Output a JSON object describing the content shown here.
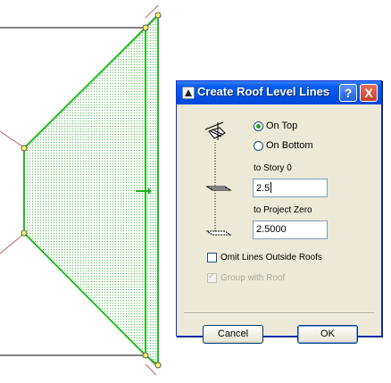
{
  "dialog": {
    "title": "Create Roof Level Lines",
    "help_button": "?",
    "close_button": "X",
    "placement": {
      "on_top_label": "On Top",
      "on_bottom_label": "On Bottom",
      "selected": "On Top"
    },
    "story": {
      "label": "to Story 0",
      "value": "2.5"
    },
    "project_zero": {
      "label": "to Project Zero",
      "value": "2.5000"
    },
    "omit_lines": {
      "label": "Omit Lines Outside Roofs",
      "checked": false
    },
    "group_with_roof": {
      "label": "Group with Roof",
      "checked": true,
      "enabled": false
    },
    "cancel_label": "Cancel",
    "ok_label": "OK"
  },
  "colors": {
    "roof_outline": "#22bb22",
    "roof_fill": "#44cc44",
    "wall_line": "#000000",
    "guide_line": "#c06060",
    "title_bar": "#0052e6",
    "dialog_bg": "#ece9d8"
  }
}
